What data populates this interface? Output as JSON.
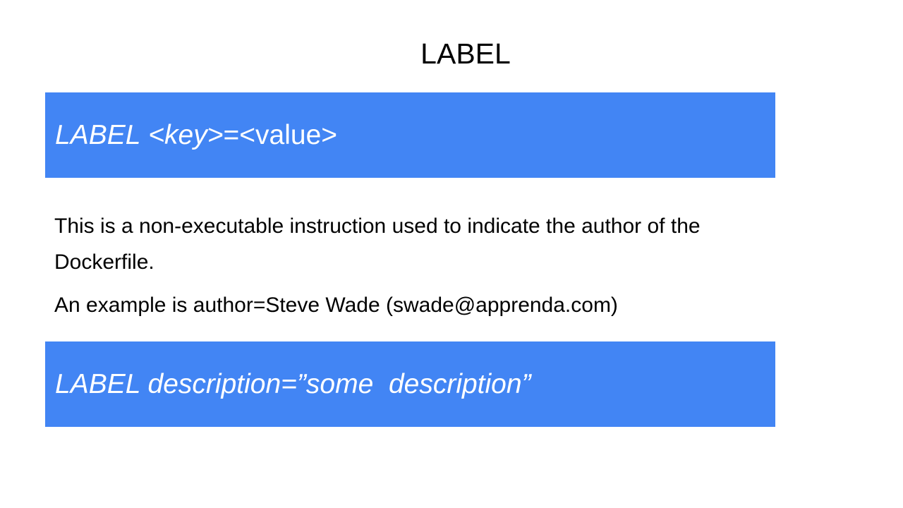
{
  "slide": {
    "title": "LABEL",
    "syntax_box": {
      "keyword": "LABEL",
      "key_part": " <key>",
      "value_part": "=<value>"
    },
    "description": "This is a non-executable instruction used to indicate the author of the Dockerfile.",
    "example": "An example is author=Steve Wade (swade@apprenda.com)",
    "example_box": {
      "text": "LABEL description=”some  description”"
    }
  },
  "colors": {
    "box_background": "#4285f4",
    "box_text": "#ffffff",
    "body_text": "#000000"
  }
}
